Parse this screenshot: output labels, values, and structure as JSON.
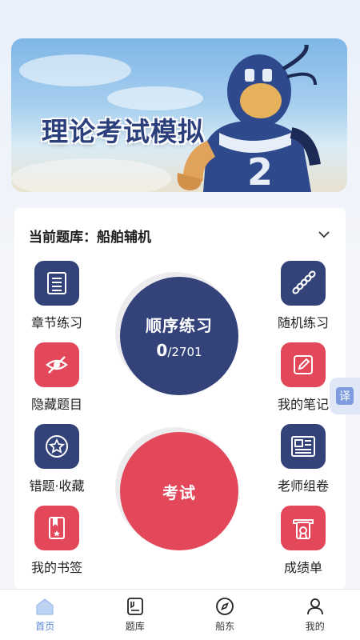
{
  "banner": {
    "title": "理论考试模拟"
  },
  "bank": {
    "label": "当前题库：船舶辅机"
  },
  "features": {
    "chapter": "章节练习",
    "random": "随机练习",
    "hidden": "隐藏题目",
    "notes": "我的笔记",
    "wrong": "错题·收藏",
    "teacher": "老师组卷",
    "bookmark": "我的书签",
    "grades": "成绩单"
  },
  "sequential": {
    "title": "顺序练习",
    "done": "0",
    "total": "/2701"
  },
  "exam": {
    "title": "考试"
  },
  "translate": {
    "label": "译"
  },
  "nav": {
    "home": "首页",
    "bank": "题库",
    "captain": "船东",
    "mine": "我的"
  },
  "colors": {
    "primary": "#34427a",
    "accent": "#e2485a",
    "nav_active": "#5b86d6"
  }
}
